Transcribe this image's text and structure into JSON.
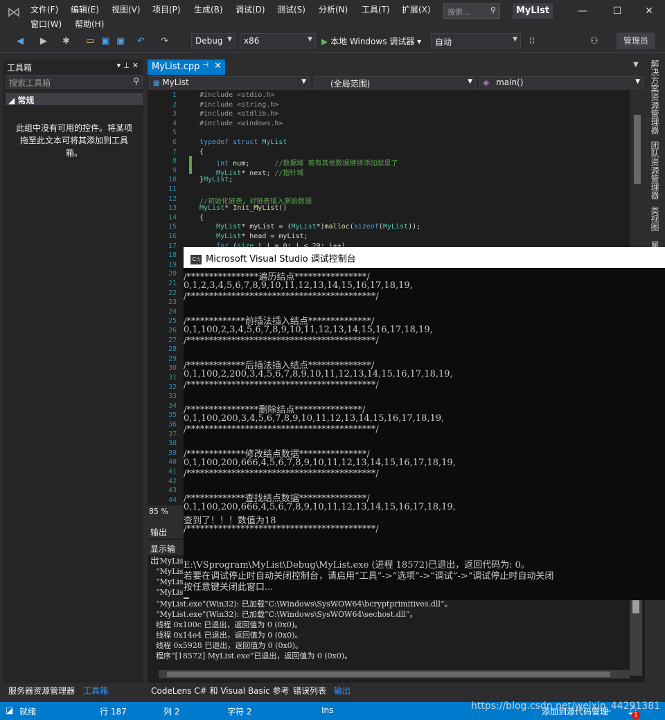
{
  "menu": {
    "row1": [
      "文件(F)",
      "编辑(E)",
      "视图(V)",
      "项目(P)",
      "生成(B)",
      "调试(D)",
      "测试(S)",
      "分析(N)",
      "工具(T)",
      "扩展(X)"
    ],
    "row2": [
      "窗口(W)",
      "帮助(H)"
    ],
    "search_placeholder": "搜索...",
    "app_title": "MyList"
  },
  "toolbar": {
    "config": "Debug",
    "platform": "x86",
    "run_label": "本地 Windows 调试器",
    "run_mode": "自动",
    "admin": "管理员"
  },
  "toolbox": {
    "title": "工具箱",
    "search_placeholder": "搜索工具箱",
    "group": "常规",
    "empty_text": "此组中没有可用的控件。将某项拖至此文本可将其添加到工具箱。"
  },
  "editor": {
    "tab": "MyList.cpp",
    "nav_project": "MyList",
    "nav_scope": "(全局范围)",
    "nav_member": "main()",
    "zoom": "85 %",
    "line_numbers": [
      "1",
      "2",
      "3",
      "4",
      "5",
      "6",
      "7",
      "8",
      "9",
      "10",
      "11",
      "12",
      "13",
      "14",
      "15",
      "16",
      "17",
      "18",
      "19",
      "20",
      "21",
      "22",
      "23",
      "24",
      "25",
      "26",
      "27",
      "28",
      "29",
      "30",
      "31",
      "32",
      "33",
      "34",
      "35",
      "36",
      "37",
      "38",
      "39",
      "40",
      "41",
      "42",
      "43",
      "44"
    ],
    "code": [
      {
        "html": "<span class='pp'>#include &lt;stdio.h&gt;</span>"
      },
      {
        "html": "<span class='pp'>#include &lt;string.h&gt;</span>"
      },
      {
        "html": "<span class='pp'>#include &lt;stdlib.h&gt;</span>"
      },
      {
        "html": "<span class='pp'>#include &lt;windows.h&gt;</span>"
      },
      {
        "html": ""
      },
      {
        "html": "<span class='kw'>typedef struct</span> <span class='ty'>MyList</span>"
      },
      {
        "html": "{"
      },
      {
        "html": "    <span class='kw'>int</span> num;      <span class='cm'>//数据域 若有其他数据继续添加就是了</span>"
      },
      {
        "html": "    <span class='ty'>MyList</span>* next; <span class='cm'>//指针域</span>"
      },
      {
        "html": "}<span class='ty'>MyList</span>;"
      },
      {
        "html": ""
      },
      {
        "html": "<span class='cm'>//初始化链表，对链表插入原始数据</span>"
      },
      {
        "html": "<span class='ty'>MyList</span>* <span class='fn'>Init_MyList</span>()"
      },
      {
        "html": "{"
      },
      {
        "html": "    <span class='ty'>MyList</span>* myList = (<span class='ty'>MyList</span>*)<span class='fn'>malloc</span>(<span class='kw'>sizeof</span>(<span class='ty'>MyList</span>));"
      },
      {
        "html": "    <span class='ty'>MyList</span>* head = myList;"
      },
      {
        "html": "    <span class='kw'>for</span> (<span class='ty'>size_t</span> i = <span class='nm'>0</span>; i &lt; <span class='nm'>20</span>; i++)"
      }
    ]
  },
  "side_tabs": [
    "解决方案资源管理器",
    "团队资源管理器",
    "类视图",
    "属"
  ],
  "console": {
    "title": "Microsoft Visual Studio 调试控制台",
    "lines": [
      "/****************遍历结点****************/",
      "0,1,2,3,4,5,6,7,8,9,10,11,12,13,14,15,16,17,18,19,",
      "/******************************************/",
      "",
      "/*************前插法插入结点**************/",
      "0,1,100,2,3,4,5,6,7,8,9,10,11,12,13,14,15,16,17,18,19,",
      "/******************************************/",
      "",
      "/*************后插法插入结点**************/",
      "0,1,100,2,200,3,4,5,6,7,8,9,10,11,12,13,14,15,16,17,18,19,",
      "/******************************************/",
      "",
      "/****************删除结点***************/",
      "0,1,100,200,3,4,5,6,7,8,9,10,11,12,13,14,15,16,17,18,19,",
      "/******************************************/",
      "",
      "/*************修改结点数据***************/",
      "0,1,100,200,666,4,5,6,7,8,9,10,11,12,13,14,15,16,17,18,19,",
      "/******************************************/",
      "",
      "/*************查找结点数据***************/",
      "0,1,100,200,666,4,5,6,7,8,9,10,11,12,13,14,15,16,17,18,19,",
      "查到了！！！数值为18",
      "/******************************************/",
      "",
      "",
      "E:\\VSprogram\\MyList\\Debug\\MyList.exe (进程 18572)已退出，返回代码为: 0。",
      "若要在调试停止时自动关闭控制台，请启用“工具”->“选项”->“调试”->“调试停止时自动关闭",
      "按任意键关闭此窗口..."
    ]
  },
  "output": {
    "title": "输出",
    "source_label": "显示输出",
    "lines": [
      "“MyLis",
      "“MyLis",
      "“MyLis",
      "“MyLis",
      "“MyList.exe”(Win32): 已加载“C:\\Windows\\SysWOW64\\bcryptprimitives.dll”。",
      "“MyList.exe”(Win32): 已加载“C:\\Windows\\SysWOW64\\sechost.dll”。",
      "线程 0x100c 已退出，返回值为 0 (0x0)。",
      "线程 0x14e4 已退出，返回值为 0 (0x0)。",
      "线程 0x5928 已退出，返回值为 0 (0x0)。",
      "程序“[18572] MyList.exe”已退出，返回值为 0 (0x0)。"
    ]
  },
  "bottom_tabs": {
    "left": [
      "服务器资源管理器",
      "工具箱"
    ],
    "right": [
      "CodeLens C# 和 Visual Basic 参考",
      "错误列表",
      "输出"
    ]
  },
  "status": {
    "ready": "就绪",
    "line": "行 187",
    "col": "列 2",
    "char": "字符 2",
    "ins": "Ins",
    "add_source": "添加到源代码管理",
    "notifications": "1"
  },
  "watermark": "https://blog.csdn.net/weixin_44291381",
  "colors": {
    "accent": "#007acc",
    "background": "#2d2d30",
    "editor": "#1e1e1e",
    "console": "#0c0c0c"
  }
}
